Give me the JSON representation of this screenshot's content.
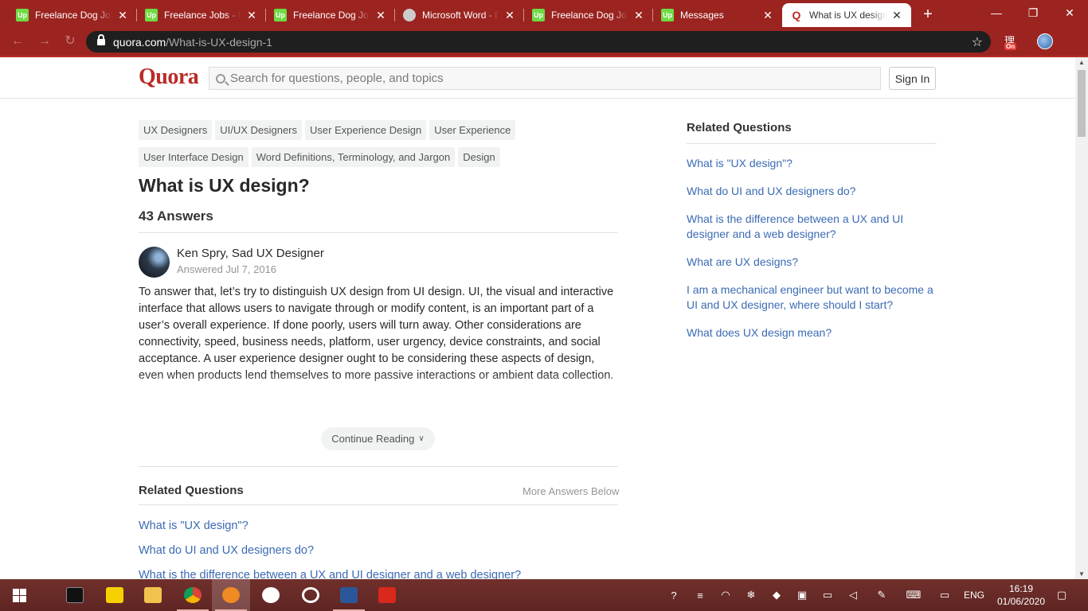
{
  "browser": {
    "tabs": [
      {
        "title": "Freelance Dog Job",
        "icon": "upwork-icon",
        "active": false
      },
      {
        "title": "Freelance Jobs - UI",
        "icon": "upwork-icon",
        "active": false
      },
      {
        "title": "Freelance Dog Job",
        "icon": "upwork-icon",
        "active": false
      },
      {
        "title": "Microsoft Word - D",
        "icon": "globe-icon",
        "active": false
      },
      {
        "title": "Freelance Dog Job",
        "icon": "upwork-icon",
        "active": false
      },
      {
        "title": "Messages",
        "icon": "upwork-icon",
        "active": false
      },
      {
        "title": "What is UX design",
        "icon": "quora-icon",
        "active": true
      }
    ],
    "url_domain": "quora.com",
    "url_path": "/What-is-UX-design-1",
    "extension_badge": "On",
    "extension_glyph": "理",
    "accent": "#9b2420"
  },
  "quora": {
    "logo": "Quora",
    "search_placeholder": "Search for questions, people, and topics",
    "signin_label": "Sign In",
    "topics": [
      "UX Designers",
      "UI/UX Designers",
      "User Experience Design",
      "User Experience",
      "User Interface Design",
      "Word Definitions, Terminology, and Jargon",
      "Design"
    ],
    "question_title": "What is UX design?",
    "answer_count": "43 Answers",
    "answer": {
      "author": "Ken Spry, Sad UX Designer",
      "answered": "Answered Jul 7, 2016",
      "body": "To answer that, let’s try to distinguish UX design from UI design. UI, the visual and interactive interface that allows users to navigate through or modify content, is an important part of a user’s overall experience. If done poorly, users will turn away. Other considerations are connectivity, speed, business needs, platform, user urgency, device constraints, and social acceptance. A user experience designer ought to be considering these aspects of design, even when products lend themselves to more passive interactions or ambient data collection."
    },
    "continue_label": "Continue Reading",
    "related_heading": "Related Questions",
    "more_answers": "More Answers Below",
    "related_inline": [
      "What is \"UX design\"?",
      "What do UI and UX designers do?",
      "What is the difference between a UX and UI designer and a web designer?"
    ],
    "sidebar_heading": "Related Questions",
    "sidebar_questions": [
      "What is \"UX design\"?",
      "What do UI and UX designers do?",
      "What is the difference between a UX and UI designer and a web designer?",
      "What are UX designs?",
      "I am a mechanical engineer but want to become a UI and UX designer, where should I start?",
      "What does UX design mean?"
    ],
    "brand_color": "#b92b27",
    "link_color": "#3b6bb3"
  },
  "taskbar": {
    "language": "ENG",
    "time": "16:19",
    "date": "01/06/2020"
  }
}
